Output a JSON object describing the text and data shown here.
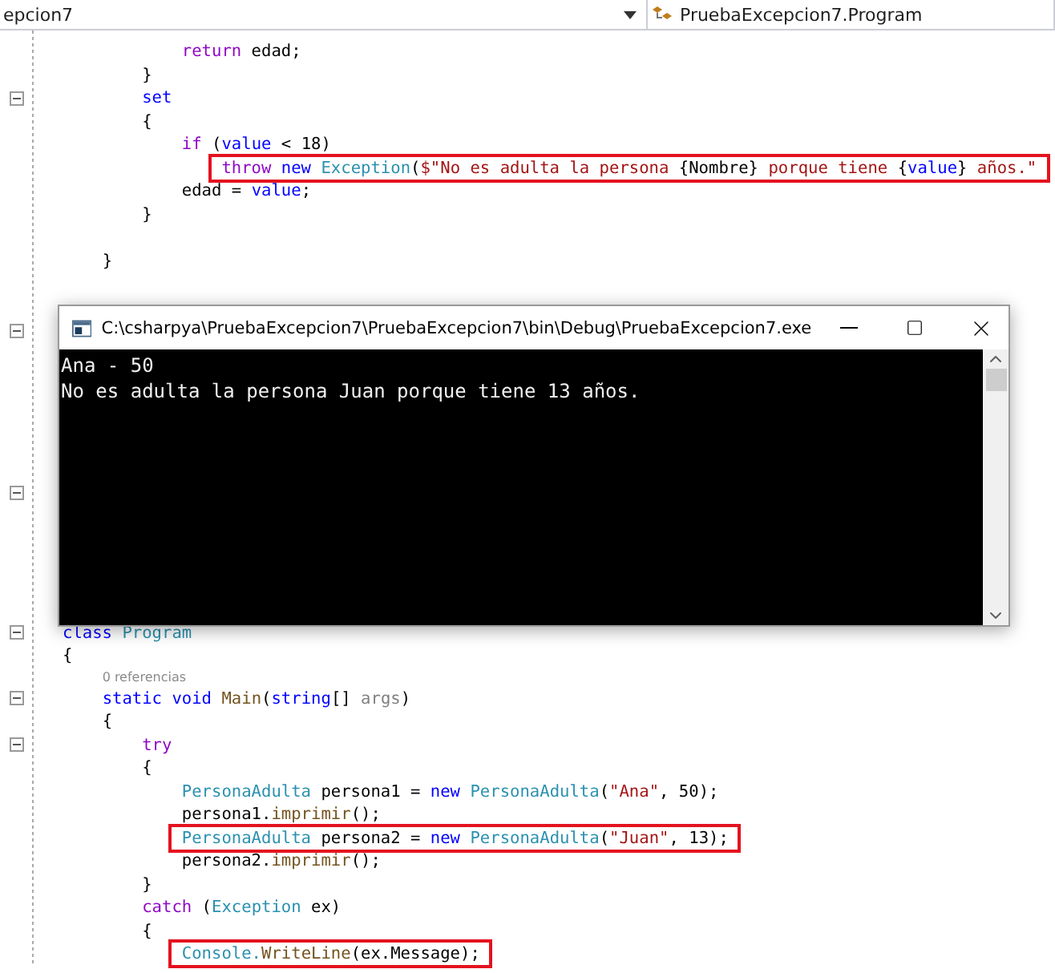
{
  "top_bar": {
    "left_dropdown": "epcion7",
    "right_dropdown": "PruebaExcepcion7.Program"
  },
  "code_lines": [
    {
      "kind": "code",
      "fold": false,
      "highlighted": false,
      "tokens": [
        {
          "kind": "control",
          "text": "            return"
        },
        {
          "kind": "plain",
          "text": " edad;"
        }
      ]
    },
    {
      "kind": "code",
      "fold": false,
      "highlighted": false,
      "tokens": [
        {
          "kind": "plain",
          "text": "        }"
        }
      ]
    },
    {
      "kind": "code",
      "fold": true,
      "highlighted": false,
      "tokens": [
        {
          "kind": "keyword",
          "text": "        set"
        }
      ]
    },
    {
      "kind": "code",
      "fold": false,
      "highlighted": false,
      "tokens": [
        {
          "kind": "plain",
          "text": "        {"
        }
      ]
    },
    {
      "kind": "code",
      "fold": false,
      "highlighted": false,
      "tokens": [
        {
          "kind": "control",
          "text": "            if"
        },
        {
          "kind": "plain",
          "text": " ("
        },
        {
          "kind": "keyword",
          "text": "value"
        },
        {
          "kind": "plain",
          "text": " < 18)"
        }
      ]
    },
    {
      "kind": "code",
      "fold": false,
      "highlighted": true,
      "tokens": [
        {
          "kind": "control",
          "text": "                throw "
        },
        {
          "kind": "keyword",
          "text": "new "
        },
        {
          "kind": "type",
          "text": "Exception"
        },
        {
          "kind": "plain",
          "text": "("
        },
        {
          "kind": "string",
          "text": "$\"No es adulta la persona "
        },
        {
          "kind": "plain",
          "text": "{Nombre}"
        },
        {
          "kind": "string",
          "text": " porque tiene "
        },
        {
          "kind": "plain",
          "text": "{"
        },
        {
          "kind": "keyword",
          "text": "value"
        },
        {
          "kind": "plain",
          "text": "}"
        },
        {
          "kind": "string",
          "text": " años.\""
        }
      ]
    },
    {
      "kind": "code",
      "fold": false,
      "highlighted": false,
      "tokens": [
        {
          "kind": "plain",
          "text": "            edad = "
        },
        {
          "kind": "keyword",
          "text": "value"
        },
        {
          "kind": "plain",
          "text": ";"
        }
      ]
    },
    {
      "kind": "code",
      "fold": false,
      "highlighted": false,
      "tokens": [
        {
          "kind": "plain",
          "text": "        }"
        }
      ]
    },
    {
      "kind": "blank"
    },
    {
      "kind": "code",
      "fold": false,
      "highlighted": false,
      "tokens": [
        {
          "kind": "plain",
          "text": "    }"
        }
      ]
    },
    {
      "kind": "covered",
      "fold": false
    },
    {
      "kind": "covered",
      "fold": false
    },
    {
      "kind": "covered",
      "fold": true
    },
    {
      "kind": "covered",
      "fold": false
    },
    {
      "kind": "covered",
      "fold": false
    },
    {
      "kind": "covered",
      "fold": false
    },
    {
      "kind": "covered",
      "fold": false
    },
    {
      "kind": "covered",
      "fold": false
    },
    {
      "kind": "covered",
      "fold": false
    },
    {
      "kind": "covered",
      "fold": true
    },
    {
      "kind": "covered",
      "fold": false
    },
    {
      "kind": "covered",
      "fold": false
    },
    {
      "kind": "covered",
      "fold": false
    },
    {
      "kind": "covered",
      "fold": false
    },
    {
      "kind": "covered",
      "fold": false
    },
    {
      "kind": "code",
      "fold": true,
      "highlighted": false,
      "tokens": [
        {
          "kind": "keyword",
          "text": "class "
        },
        {
          "kind": "type",
          "text": "Program"
        }
      ]
    },
    {
      "kind": "code",
      "fold": false,
      "highlighted": false,
      "tokens": [
        {
          "kind": "plain",
          "text": "{"
        }
      ]
    },
    {
      "kind": "refs",
      "text": "    0 referencias"
    },
    {
      "kind": "code",
      "fold": true,
      "highlighted": false,
      "tokens": [
        {
          "kind": "keyword",
          "text": "    static void "
        },
        {
          "kind": "method",
          "text": "Main"
        },
        {
          "kind": "plain",
          "text": "("
        },
        {
          "kind": "keyword",
          "text": "string"
        },
        {
          "kind": "plain",
          "text": "[] "
        },
        {
          "kind": "parameter",
          "text": "args"
        },
        {
          "kind": "plain",
          "text": ")"
        }
      ]
    },
    {
      "kind": "code",
      "fold": false,
      "highlighted": false,
      "tokens": [
        {
          "kind": "plain",
          "text": "    {"
        }
      ]
    },
    {
      "kind": "code",
      "fold": true,
      "highlighted": false,
      "tokens": [
        {
          "kind": "control",
          "text": "        try"
        }
      ]
    },
    {
      "kind": "code",
      "fold": false,
      "highlighted": false,
      "tokens": [
        {
          "kind": "plain",
          "text": "        {"
        }
      ]
    },
    {
      "kind": "code",
      "fold": false,
      "highlighted": false,
      "tokens": [
        {
          "kind": "type",
          "text": "            PersonaAdulta"
        },
        {
          "kind": "plain",
          "text": " persona1 = "
        },
        {
          "kind": "keyword",
          "text": "new "
        },
        {
          "kind": "type",
          "text": "PersonaAdulta"
        },
        {
          "kind": "plain",
          "text": "("
        },
        {
          "kind": "string",
          "text": "\"Ana\""
        },
        {
          "kind": "plain",
          "text": ", 50);"
        }
      ]
    },
    {
      "kind": "code",
      "fold": false,
      "highlighted": false,
      "tokens": [
        {
          "kind": "plain",
          "text": "            persona1."
        },
        {
          "kind": "method",
          "text": "imprimir"
        },
        {
          "kind": "plain",
          "text": "();"
        }
      ]
    },
    {
      "kind": "code",
      "fold": false,
      "highlighted": true,
      "tokens": [
        {
          "kind": "type",
          "text": "            PersonaAdulta"
        },
        {
          "kind": "plain",
          "text": " persona2 = "
        },
        {
          "kind": "keyword",
          "text": "new "
        },
        {
          "kind": "type",
          "text": "PersonaAdulta"
        },
        {
          "kind": "plain",
          "text": "("
        },
        {
          "kind": "string",
          "text": "\"Juan\""
        },
        {
          "kind": "plain",
          "text": ", 13);"
        }
      ]
    },
    {
      "kind": "code",
      "fold": false,
      "highlighted": false,
      "tokens": [
        {
          "kind": "plain",
          "text": "            persona2."
        },
        {
          "kind": "method",
          "text": "imprimir"
        },
        {
          "kind": "plain",
          "text": "();"
        }
      ]
    },
    {
      "kind": "code",
      "fold": false,
      "highlighted": false,
      "tokens": [
        {
          "kind": "plain",
          "text": "        }"
        }
      ]
    },
    {
      "kind": "code",
      "fold": false,
      "highlighted": false,
      "tokens": [
        {
          "kind": "control",
          "text": "        catch"
        },
        {
          "kind": "plain",
          "text": " ("
        },
        {
          "kind": "type",
          "text": "Exception"
        },
        {
          "kind": "plain",
          "text": " ex)"
        }
      ]
    },
    {
      "kind": "code",
      "fold": false,
      "highlighted": false,
      "tokens": [
        {
          "kind": "plain",
          "text": "        {"
        }
      ]
    },
    {
      "kind": "code",
      "fold": false,
      "highlighted": true,
      "tokens": [
        {
          "kind": "type",
          "text": "            Console."
        },
        {
          "kind": "method",
          "text": "WriteLine"
        },
        {
          "kind": "plain",
          "text": "(ex.Message);"
        }
      ]
    }
  ],
  "console": {
    "title": "C:\\csharpya\\PruebaExcepcion7\\PruebaExcepcion7\\bin\\Debug\\PruebaExcepcion7.exe",
    "lines": [
      "Ana - 50",
      "No es adulta la persona Juan porque tiene 13 años."
    ]
  }
}
